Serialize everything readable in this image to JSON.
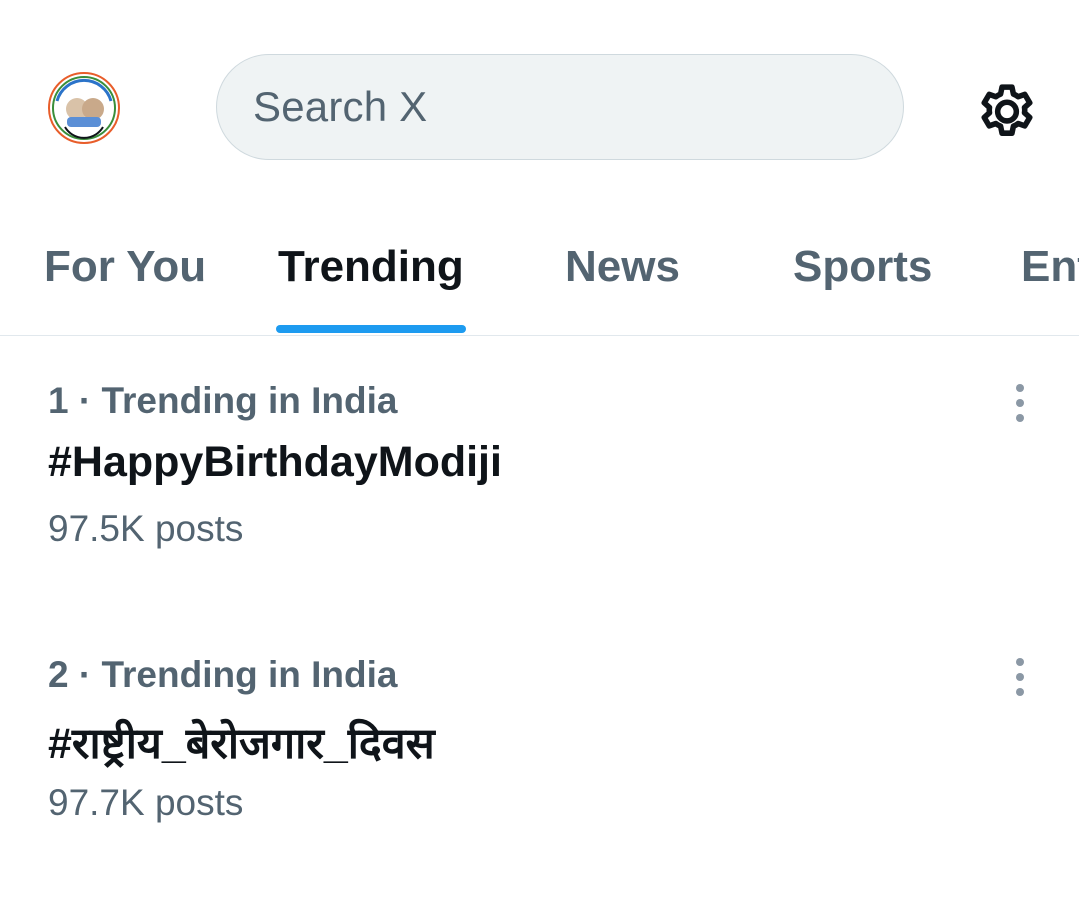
{
  "header": {
    "avatar_icon": "profile-avatar",
    "search": {
      "placeholder": "Search X",
      "icon": "none"
    },
    "settings_icon": "gear-icon"
  },
  "tabs": [
    {
      "label": "For You",
      "active": false
    },
    {
      "label": "Trending",
      "active": true
    },
    {
      "label": "News",
      "active": false
    },
    {
      "label": "Sports",
      "active": false
    },
    {
      "label": "Ent",
      "active": false
    }
  ],
  "trends": [
    {
      "meta": "1 · Trending in India",
      "title": "#HappyBirthdayModiji",
      "count": "97.5K posts"
    },
    {
      "meta": "2 · Trending in India",
      "title": "#राष्ट्रीय_बेरोजगार_दिवस",
      "count": "97.7K posts"
    }
  ],
  "colors": {
    "accent": "#1d9bf0",
    "text_primary": "#0f1419",
    "text_secondary": "#536471",
    "search_bg": "#eff3f4",
    "divider": "#e1e8ed"
  }
}
